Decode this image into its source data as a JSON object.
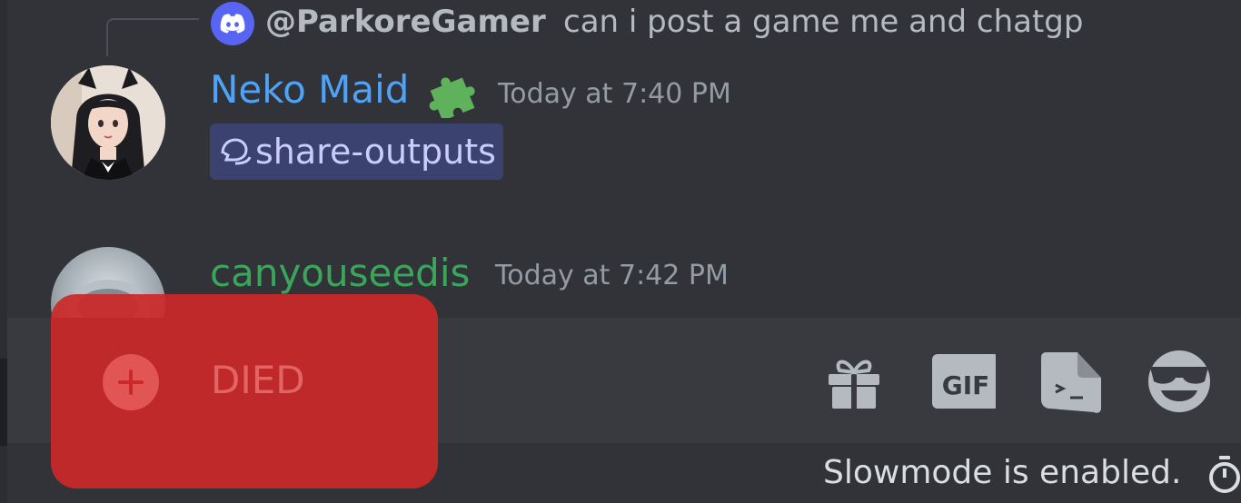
{
  "reply": {
    "author": "@ParkoreGamer",
    "text": "can i post a game me and chatgp",
    "avatar_icon": "discord-logo-icon",
    "avatar_color": "#5865f2"
  },
  "messages": [
    {
      "username": "Neko Maid",
      "username_color": "#4fa3f7",
      "badge_icon": "puzzle-piece-icon",
      "timestamp": "Today at 7:40 PM",
      "channel_mention": "share-outputs",
      "channel_icon": "thread-icon"
    },
    {
      "username": "canyouseedis",
      "username_color": "#3ba55c",
      "timestamp": "Today at 7:42 PM"
    }
  ],
  "composer": {
    "toolbar": [
      "gift-icon",
      "gif-icon",
      "sticker-icon",
      "emoji-icon"
    ]
  },
  "overlay": {
    "label": "DIED",
    "icon": "plus-icon",
    "color": "#cc2828"
  },
  "footer": {
    "slowmode_text": "Slowmode is enabled.",
    "timer_icon": "stopwatch-icon"
  }
}
